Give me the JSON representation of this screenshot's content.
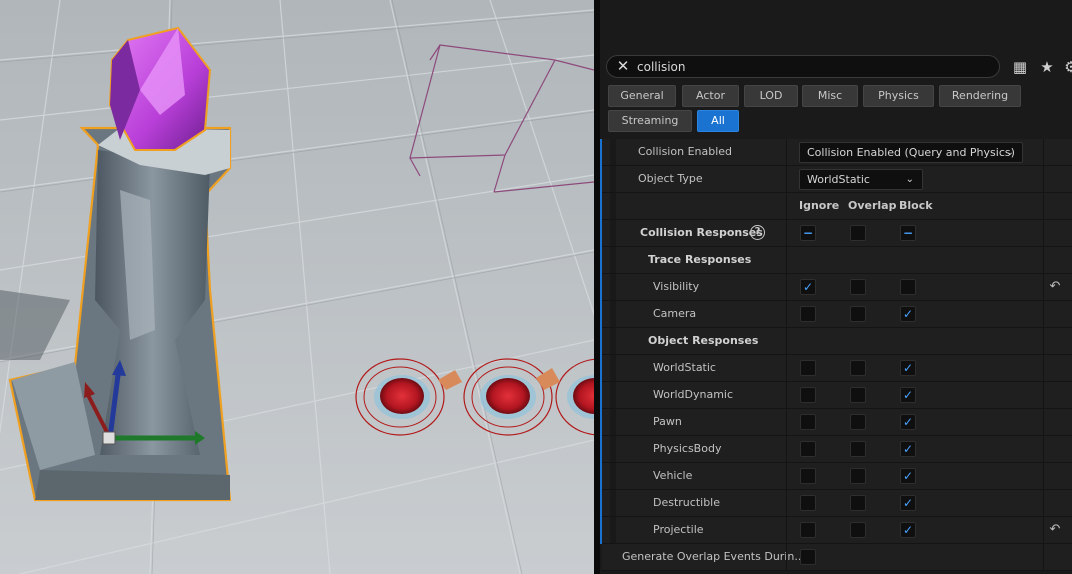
{
  "search": {
    "value": "collision",
    "placeholder": ""
  },
  "toolbar_icons": [
    "table-view-icon",
    "favorite-icon",
    "settings-icon"
  ],
  "filter_tabs": [
    "General",
    "Actor",
    "LOD",
    "Misc",
    "Physics",
    "Rendering",
    "Streaming",
    "All"
  ],
  "active_tab": "All",
  "collision_enabled": {
    "label": "Collision Enabled",
    "value": "Collision Enabled (Query and Physics)"
  },
  "object_type": {
    "label": "Object Type",
    "value": "WorldStatic"
  },
  "columns": {
    "ignore": "Ignore",
    "overlap": "Overlap",
    "block": "Block"
  },
  "collision_responses": {
    "label": "Collision Responses",
    "help": "?",
    "ignore": "mixed",
    "overlap": false,
    "block": "mixed"
  },
  "trace_responses": {
    "label": "Trace Responses",
    "items": [
      {
        "label": "Visibility",
        "ignore": true,
        "overlap": false,
        "block": false,
        "reset": true
      },
      {
        "label": "Camera",
        "ignore": false,
        "overlap": false,
        "block": true,
        "reset": false
      }
    ]
  },
  "object_responses": {
    "label": "Object Responses",
    "items": [
      {
        "label": "WorldStatic",
        "ignore": false,
        "overlap": false,
        "block": true,
        "reset": false
      },
      {
        "label": "WorldDynamic",
        "ignore": false,
        "overlap": false,
        "block": true,
        "reset": false
      },
      {
        "label": "Pawn",
        "ignore": false,
        "overlap": false,
        "block": true,
        "reset": false
      },
      {
        "label": "PhysicsBody",
        "ignore": false,
        "overlap": false,
        "block": true,
        "reset": false
      },
      {
        "label": "Vehicle",
        "ignore": false,
        "overlap": false,
        "block": true,
        "reset": false
      },
      {
        "label": "Destructible",
        "ignore": false,
        "overlap": false,
        "block": true,
        "reset": false
      },
      {
        "label": "Projectile",
        "ignore": false,
        "overlap": false,
        "block": true,
        "reset": true
      }
    ]
  },
  "generate_overlap": {
    "label": "Generate Overlap Events Durin...",
    "checked": false
  },
  "colors": {
    "accent": "#1a73d1",
    "check": "#4aa3ff",
    "selection_outline": "#f0a020",
    "crystal": "#c24be0"
  }
}
